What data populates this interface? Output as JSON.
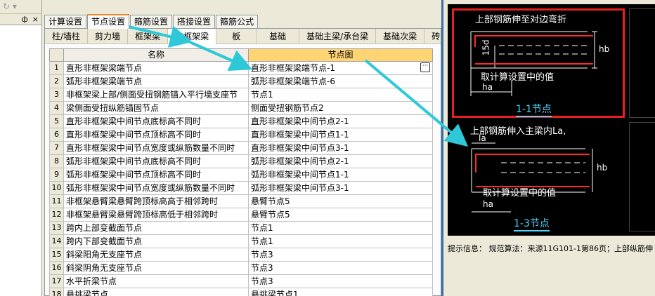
{
  "top_tabs": [
    "计算设置",
    "节点设置",
    "箍筋设置",
    "搭接设置",
    "箍筋公式"
  ],
  "sub_tabs": [
    "柱/墙柱",
    "剪力墙",
    "框架梁",
    "非框架梁",
    "板",
    "基础",
    "基础主梁/承台梁",
    "基础次梁",
    "砖"
  ],
  "left_pane": {
    "toolbar": "↻ ▾",
    "pin": "ф",
    "close": "×"
  },
  "grid": {
    "columns": [
      "名称",
      "节点图"
    ],
    "ellipsis": "···",
    "rows": [
      {
        "num": "1",
        "name": "直形非框架梁端节点",
        "node": "直形非框架梁端节点-1"
      },
      {
        "num": "2",
        "name": "弧形非框架梁端节点",
        "node": "弧形非框架梁端节点-6"
      },
      {
        "num": "3",
        "name": "非框架梁上部/侧面受扭钢筋锚入平行墙支座节",
        "node": "节点1"
      },
      {
        "num": "4",
        "name": "梁侧面受扭纵筋锚固节点",
        "node": "侧面受扭钢筋节点2"
      },
      {
        "num": "5",
        "name": "直形非框架梁中间节点底标高不同时",
        "node": "直形非框架梁中间节点2-1"
      },
      {
        "num": "6",
        "name": "直形非框架梁中间节点顶标高不同时",
        "node": "直形非框架梁中间节点1-1"
      },
      {
        "num": "7",
        "name": "直形非框架梁中间节点宽度或纵筋数量不同时",
        "node": "直形非框架梁中间节点3-1"
      },
      {
        "num": "8",
        "name": "弧形非框架梁中间节点底标高不同时",
        "node": "弧形非框架梁中间节点2-1"
      },
      {
        "num": "9",
        "name": "弧形非框架梁中间节点顶标高不同时",
        "node": "弧形非框架梁中间节点1-1"
      },
      {
        "num": "10",
        "name": "弧形非框架梁中间节点宽度或纵筋数量不同时",
        "node": "弧形非框架梁中间节点3-1"
      },
      {
        "num": "11",
        "name": "非框架悬臂梁悬臂跨顶标高高于相邻跨时",
        "node": "悬臂节点5"
      },
      {
        "num": "12",
        "name": "非框架悬臂梁悬臂跨顶标高低于相邻跨时",
        "node": "悬臂节点5"
      },
      {
        "num": "13",
        "name": "跨内上部变截面节点",
        "node": "节点1"
      },
      {
        "num": "14",
        "name": "跨内下部变截面节点",
        "node": "节点1"
      },
      {
        "num": "15",
        "name": "斜梁阳角无支座节点",
        "node": "节点3"
      },
      {
        "num": "16",
        "name": "斜梁阴角无支座节点",
        "node": "节点3"
      },
      {
        "num": "17",
        "name": "水平折梁节点",
        "node": "节点3"
      },
      {
        "num": "18",
        "name": "悬挑梁节点",
        "node": "悬挑梁节点1"
      }
    ]
  },
  "preview": {
    "diagram1": {
      "title": "上部钢筋伸至对边弯折",
      "dim1": "15d",
      "dim2": "ha",
      "dim3": "hb",
      "note": "取计算设置中的值",
      "caption": "1-1节点"
    },
    "diagram2": {
      "title": "上部钢筋伸入主梁内La,",
      "dim1": "la",
      "dim2": "ha",
      "dim3": "hb",
      "note": "取计算设置中的值",
      "caption": "1-3节点"
    },
    "info": "提示信息： 规范算法：来源11G101-1第86页；上部纵筋伸"
  },
  "colors": {
    "accent": "#e68b2c",
    "header_node": "#ffd573",
    "diagram_bg": "#000000",
    "highlight": "#e82020",
    "caption": "#4ad6ff",
    "arrow": "#2ec8d8"
  }
}
